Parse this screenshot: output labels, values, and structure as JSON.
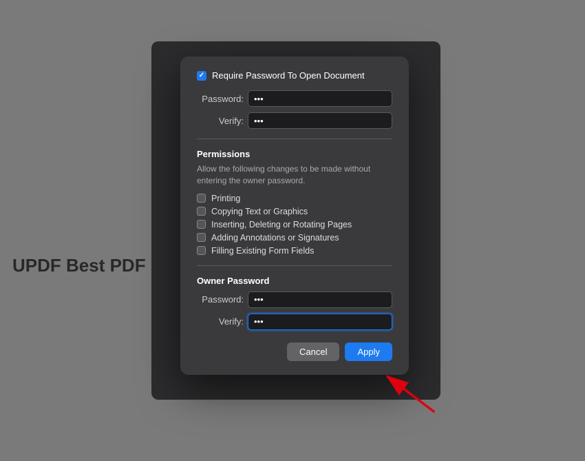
{
  "background": {
    "color": "#888888",
    "label": "UPDF Best PDF Ed"
  },
  "dialog": {
    "require_password": {
      "label": "Require Password To Open Document",
      "checked": true
    },
    "password_row": {
      "label": "Password:",
      "value": "•••"
    },
    "verify_row": {
      "label": "Verify:",
      "value": "•••"
    },
    "permissions": {
      "title": "Permissions",
      "description": "Allow the following changes to be made without entering the owner password.",
      "items": [
        {
          "label": "Printing",
          "checked": false
        },
        {
          "label": "Copying Text or Graphics",
          "checked": false
        },
        {
          "label": "Inserting, Deleting or Rotating Pages",
          "checked": false
        },
        {
          "label": "Adding Annotations or Signatures",
          "checked": false
        },
        {
          "label": "Filling Existing Form Fields",
          "checked": false
        }
      ]
    },
    "owner_password": {
      "title": "Owner Password",
      "password_row": {
        "label": "Password:",
        "value": "•••"
      },
      "verify_row": {
        "label": "Verify:",
        "value": "•••",
        "focused": true
      }
    },
    "buttons": {
      "cancel": "Cancel",
      "apply": "Apply"
    }
  }
}
